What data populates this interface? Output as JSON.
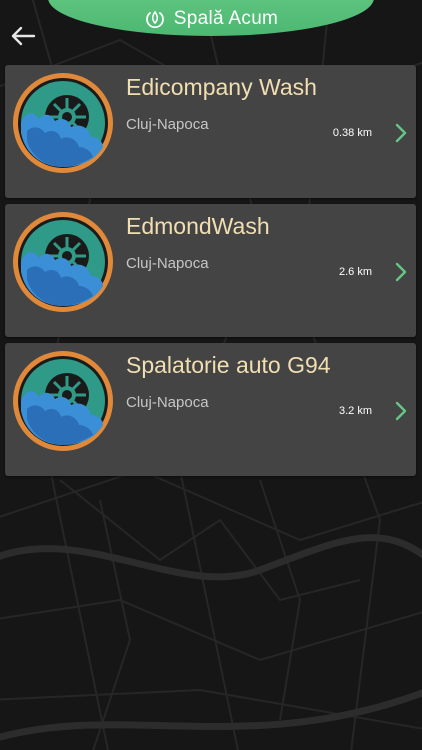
{
  "header": {
    "title": "Spală Acum",
    "icon": "power-leaf-icon"
  },
  "nav": {
    "back_icon": "arrow-left-icon"
  },
  "colors": {
    "accent": "#5cc27c",
    "card_bg": "#444444",
    "name_color": "#f1dfb2",
    "city_color": "#c6c6c6",
    "chevron": "#66c785",
    "logo_ring": "#e0893a"
  },
  "results": [
    {
      "name": "Edicompany Wash",
      "city": "Cluj-Napoca",
      "distance": "0.38 km"
    },
    {
      "name": "EdmondWash",
      "city": "Cluj-Napoca",
      "distance": "2.6 km"
    },
    {
      "name": "Spalatorie auto G94",
      "city": "Cluj-Napoca",
      "distance": "3.2 km"
    }
  ]
}
